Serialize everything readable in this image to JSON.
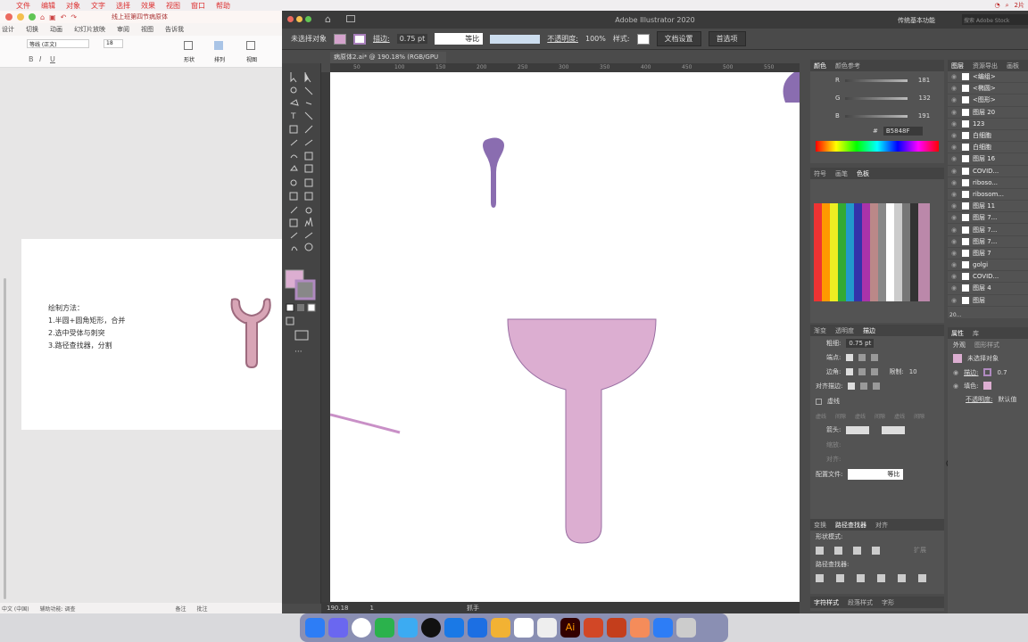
{
  "mac_menu": {
    "items": [
      "文件",
      "编辑",
      "对象",
      "文字",
      "选择",
      "效果",
      "视图",
      "窗口",
      "帮助"
    ],
    "right": "2片"
  },
  "ppt": {
    "title": "线上班第四节病原体",
    "tabs": [
      "设计",
      "切换",
      "动画",
      "幻灯片放映",
      "审阅",
      "视图",
      "告诉我"
    ],
    "font_name": "等线 (正文)",
    "font_size": "18",
    "ribbon_labels": [
      "形状",
      "排列",
      "视图"
    ],
    "slide_heading": "绘制方法：",
    "slide_lines": [
      "1.半圆+圆角矩形，合并",
      "2.选中受体与刺突",
      "3.路径查找器，分割"
    ],
    "status": [
      "中文 (中国)",
      "辅助功能: 调查",
      "备注",
      "批注"
    ]
  },
  "ai": {
    "title": "Adobe Illustrator 2020",
    "workspace": "传统基本功能",
    "search_placeholder": "搜索 Adobe Stock",
    "control": {
      "no_selection": "未选择对象",
      "stroke_label": "描边:",
      "stroke_value": "0.75 pt",
      "stroke_profile": "等比",
      "opacity_label": "不透明度:",
      "opacity_value": "100%",
      "style_label": "样式:",
      "doc_settings": "文档设置",
      "preferences": "首选项"
    },
    "doc_tab": "病原体2.ai* @ 190.18% (RGB/GPU 预览)",
    "ruler_ticks": [
      "50",
      "100",
      "150",
      "200",
      "250",
      "300",
      "350",
      "400",
      "450",
      "500",
      "550"
    ],
    "status": {
      "zoom": "190.18",
      "page": "1",
      "mode": "抓手"
    },
    "color_panel": {
      "tabs": [
        "颜色",
        "颜色参考"
      ],
      "r_label": "R",
      "r": "181",
      "g_label": "G",
      "g": "132",
      "b_label": "B",
      "b": "191",
      "hex": "B5848F"
    },
    "swatch_panel": {
      "tabs": [
        "符号",
        "画笔",
        "色板"
      ]
    },
    "stroke_panel": {
      "tabs": [
        "渐变",
        "透明度",
        "描边"
      ],
      "weight_label": "粗细:",
      "weight": "0.75 pt",
      "cap_label": "端点:",
      "corner_label": "边角:",
      "limit_label": "限制:",
      "limit": "10",
      "align_label": "对齐描边:",
      "dashed_label": "虚线",
      "dash_cols": [
        "虚线",
        "间隙",
        "虚线",
        "间隙",
        "虚线",
        "间隙"
      ],
      "arrow_label": "箭头:",
      "scale_label": "缩放:",
      "align2_label": "对齐:",
      "profile_label": "配置文件:",
      "profile_value": "等比"
    },
    "pathfinder": {
      "tabs": [
        "变换",
        "路径查找器",
        "对齐"
      ],
      "shape_modes": "形状模式:",
      "expand": "扩展",
      "pathfinders": "路径查找器:"
    },
    "char_tabs": [
      "字符样式",
      "段落样式",
      "字形"
    ],
    "layers": {
      "tabs": [
        "图层",
        "资源导出",
        "画板"
      ],
      "items": [
        "<编组>",
        "<椭圆>",
        "<图形>",
        "图层 20",
        "123",
        "白细胞",
        "白细胞",
        "图层 16",
        "COVID...",
        "riboso...",
        "ribosom...",
        "图层 11",
        "图层 7...",
        "图层 7...",
        "图层 7...",
        "图层 7",
        "golgi",
        "COVID...",
        "图层 4",
        "图层"
      ],
      "count": "20..."
    },
    "props": {
      "tabs": [
        "属性",
        "库"
      ],
      "section": "外观",
      "section2": "图形样式",
      "no_selection": "未选择对象",
      "stroke_label": "描边:",
      "stroke_value": "0.7",
      "fill_label": "填色:",
      "opacity_label": "不透明度:",
      "opacity_value": "默认值"
    }
  },
  "colors": {
    "shape_fill": "#dcaed1",
    "shape_stroke": "#9a6fa3",
    "dark_purple": "#8a6db0",
    "ppt_shape": "#d8a5b6"
  }
}
